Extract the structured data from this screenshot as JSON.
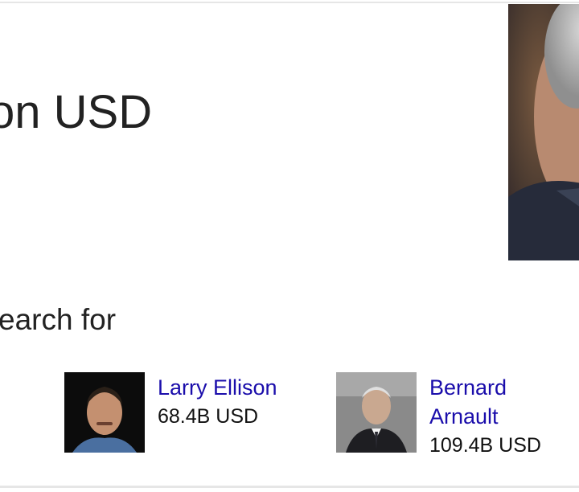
{
  "answer": {
    "headline": "on USD"
  },
  "people_also_search": {
    "heading": "earch for",
    "people": [
      {
        "name": "Larry Ellison",
        "net_worth": "68.4B USD"
      },
      {
        "name": "Bernard Arnault",
        "net_worth": "109.4B USD"
      }
    ]
  }
}
